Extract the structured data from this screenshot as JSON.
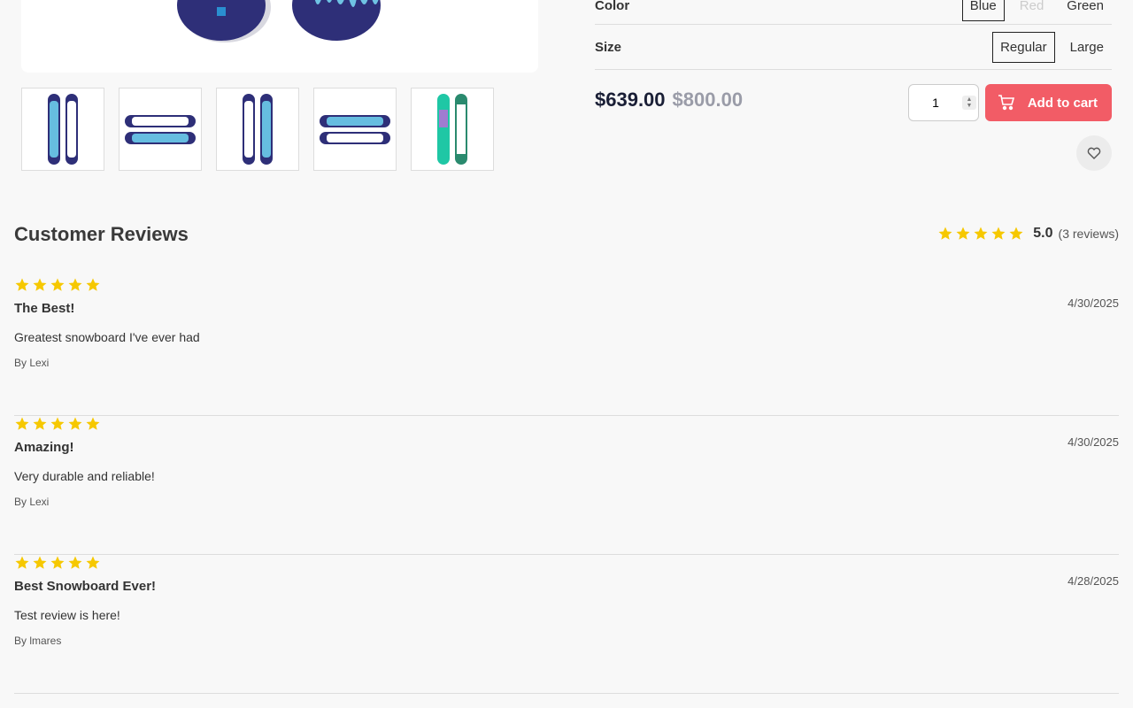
{
  "product": {
    "options": {
      "color_label": "Color",
      "colors": [
        "Blue",
        "Red",
        "Green"
      ],
      "size_label": "Size",
      "sizes": [
        "Regular",
        "Large"
      ]
    },
    "price": "$639.00",
    "compare_price": "$800.00",
    "quantity": "1",
    "add_to_cart_label": "Add to cart",
    "thumbnail_icons": [
      "snowboard-liquid-blue-front",
      "snowboard-liquid-blue-pair",
      "snowboard-liquid-blue-single",
      "snowboard-liquid-blue-pair-rotated",
      "snowboard-green-geometric"
    ]
  },
  "reviews": {
    "title": "Customer Reviews",
    "average": "5.0",
    "count_label": "(3 reviews)",
    "star_color": "#f6c800",
    "items": [
      {
        "title": "The Best!",
        "body": "Greatest snowboard I've ever had",
        "author": "By Lexi",
        "date": "4/30/2025"
      },
      {
        "title": "Amazing!",
        "body": "Very durable and reliable!",
        "author": "By Lexi",
        "date": "4/30/2025"
      },
      {
        "title": "Best Snowboard Ever!",
        "body": "Test review is here!",
        "author": "By lmares",
        "date": "4/28/2025"
      }
    ]
  },
  "colors": {
    "accent": "#f25c66",
    "price": "#1a1f36",
    "compare": "#9a9ca8"
  }
}
